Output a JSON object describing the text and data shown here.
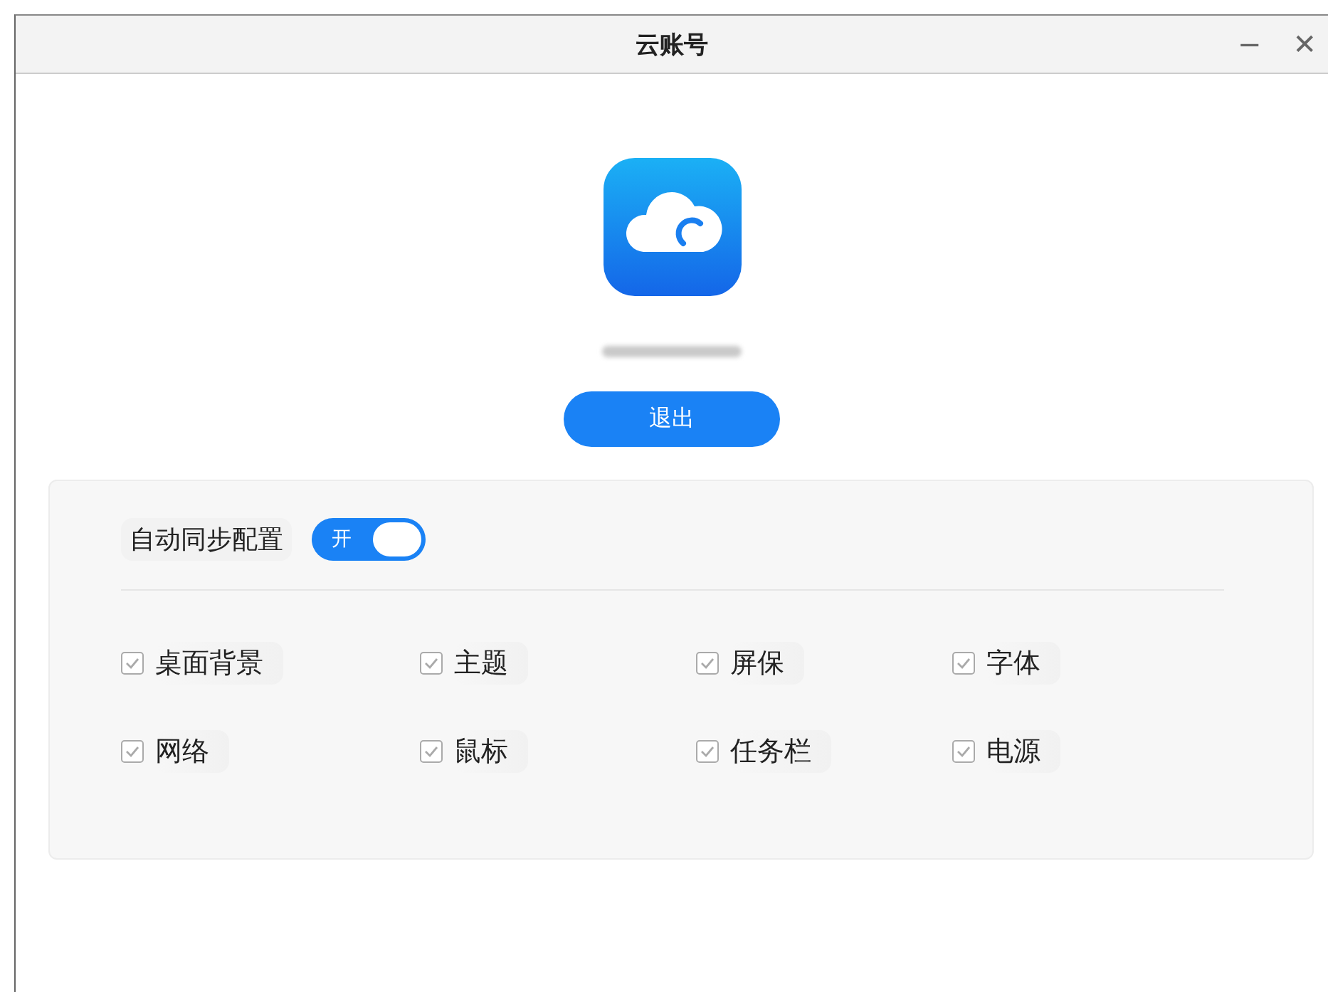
{
  "window": {
    "title": "云账号",
    "controls": [
      "−",
      "✕"
    ]
  },
  "account": {
    "logout_button": "退出"
  },
  "sync": {
    "label": "自动同步配置",
    "toggle": {
      "on": true,
      "label": "开"
    },
    "items": [
      {
        "label": "桌面背景",
        "checked": true
      },
      {
        "label": "主题",
        "checked": true
      },
      {
        "label": "屏保",
        "checked": true
      },
      {
        "label": "字体",
        "checked": true
      },
      {
        "label": "网络",
        "checked": true
      },
      {
        "label": "鼠标",
        "checked": true
      },
      {
        "label": "任务栏",
        "checked": true
      },
      {
        "label": "电源",
        "checked": true
      }
    ]
  }
}
